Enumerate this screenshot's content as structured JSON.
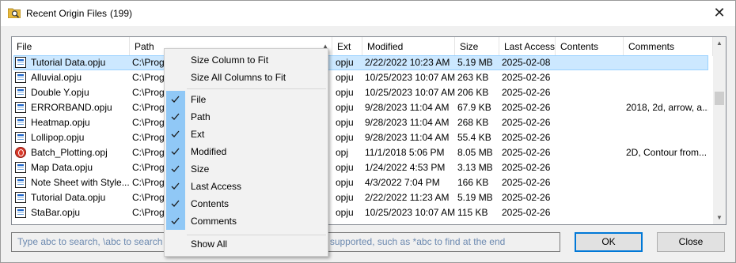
{
  "window": {
    "title": "Recent Origin Files",
    "count": "(199)",
    "close_glyph": "✕"
  },
  "columns": {
    "file": "File",
    "path": "Path",
    "ext": "Ext",
    "modified": "Modified",
    "size": "Size",
    "last_access": "Last Access",
    "contents": "Contents",
    "comments": "Comments"
  },
  "rows": [
    {
      "file": "Tutorial Data.opju",
      "path": "C:\\Prog",
      "ext": "opju",
      "modified": "2/22/2022 10:23 AM",
      "size": "5.19 MB",
      "last_access": "2025-02-08",
      "contents": "",
      "comments": "",
      "icon": "grid-file-icon",
      "selected": true
    },
    {
      "file": "Alluvial.opju",
      "path": "C:\\Prog",
      "ext": "opju",
      "modified": "10/25/2023 10:07 AM",
      "size": "263 KB",
      "last_access": "2025-02-26",
      "contents": "",
      "comments": "",
      "icon": "grid-file-icon"
    },
    {
      "file": "Double Y.opju",
      "path": "C:\\Prog",
      "ext": "opju",
      "modified": "10/25/2023 10:07 AM",
      "size": "206 KB",
      "last_access": "2025-02-26",
      "contents": "",
      "comments": "",
      "icon": "grid-file-icon"
    },
    {
      "file": "ERRORBAND.opju",
      "path": "C:\\Prog",
      "ext": "opju",
      "modified": "9/28/2023 11:04 AM",
      "size": "67.9 KB",
      "last_access": "2025-02-26",
      "contents": "",
      "comments": "2018, 2d, arrow, a...",
      "icon": "grid-file-icon"
    },
    {
      "file": "Heatmap.opju",
      "path": "C:\\Prog",
      "ext": "opju",
      "modified": "9/28/2023 11:04 AM",
      "size": "268 KB",
      "last_access": "2025-02-26",
      "contents": "",
      "comments": "",
      "icon": "grid-file-icon"
    },
    {
      "file": "Lollipop.opju",
      "path": "C:\\Prog",
      "ext": "opju",
      "modified": "9/28/2023 11:04 AM",
      "size": "55.4 KB",
      "last_access": "2025-02-26",
      "contents": "",
      "comments": "",
      "icon": "grid-file-icon"
    },
    {
      "file": "Batch_Plotting.opj",
      "path": "C:\\Prog",
      "ext": "opj",
      "modified": "11/1/2018 5:06 PM",
      "size": "8.05 MB",
      "last_access": "2025-02-26",
      "contents": "",
      "comments": "2D, Contour from...",
      "icon": "opj-file-icon"
    },
    {
      "file": "Map Data.opju",
      "path": "C:\\Prog",
      "ext": "opju",
      "modified": "1/24/2022 4:53 PM",
      "size": "3.13 MB",
      "last_access": "2025-02-26",
      "contents": "",
      "comments": "",
      "icon": "grid-file-icon"
    },
    {
      "file": "Note Sheet with Style...",
      "path": "C:\\Prog",
      "ext": "opju",
      "modified": "4/3/2022 7:04 PM",
      "size": "166 KB",
      "last_access": "2025-02-26",
      "contents": "",
      "comments": "",
      "icon": "grid-file-icon"
    },
    {
      "file": "Tutorial Data.opju",
      "path": "C:\\Prog",
      "ext": "opju",
      "modified": "2/22/2022 11:23 AM",
      "size": "5.19 MB",
      "last_access": "2025-02-26",
      "contents": "",
      "comments": "",
      "icon": "grid-file-icon"
    },
    {
      "file": "StaBar.opju",
      "path": "C:\\Prog",
      "ext": "opju",
      "modified": "10/25/2023 10:07 AM",
      "size": "115 KB",
      "last_access": "2025-02-26",
      "contents": "",
      "comments": "",
      "icon": "grid-file-icon"
    }
  ],
  "context_menu": {
    "size_column": "Size Column to Fit",
    "size_all": "Size All Columns to Fit",
    "items": [
      {
        "label": "File",
        "checked": true
      },
      {
        "label": "Path",
        "checked": true
      },
      {
        "label": "Ext",
        "checked": true
      },
      {
        "label": "Modified",
        "checked": true
      },
      {
        "label": "Size",
        "checked": true
      },
      {
        "label": "Last Access",
        "checked": true
      },
      {
        "label": "Contents",
        "checked": true
      },
      {
        "label": "Comments",
        "checked": true
      }
    ],
    "show_all": "Show All"
  },
  "search": {
    "left_text": "Type abc to search, \\abc to search p",
    "right_text": "s (* and ?) are supported, such as *abc to find at the end"
  },
  "buttons": {
    "ok": "OK",
    "close": "Close"
  },
  "colors": {
    "selection": "#cce8ff",
    "menu_check_bg": "#90c8f6",
    "ok_border": "#0078d7"
  }
}
